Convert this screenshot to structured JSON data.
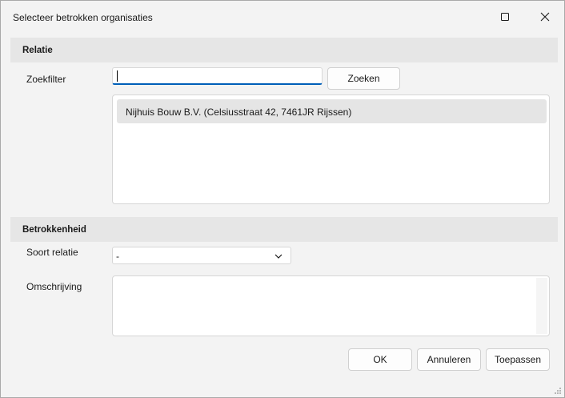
{
  "window": {
    "title": "Selecteer betrokken organisaties"
  },
  "relatie": {
    "header": "Relatie",
    "zoekfilter_label": "Zoekfilter",
    "search_value": "",
    "search_button": "Zoeken",
    "results": [
      "Nijhuis Bouw B.V.  (Celsiusstraat 42, 7461JR Rijssen)"
    ]
  },
  "betrokkenheid": {
    "header": "Betrokkenheid",
    "soort_relatie_label": "Soort relatie",
    "soort_relatie_value": "-",
    "omschrijving_label": "Omschrijving",
    "omschrijving_value": ""
  },
  "footer": {
    "ok": "OK",
    "cancel": "Annuleren",
    "apply": "Toepassen"
  },
  "colors": {
    "accent": "#005fb8",
    "background": "#f3f3f3",
    "section_header": "#e6e6e6",
    "selected_row": "#e5e5e5"
  },
  "icons": {
    "maximize": "maximize-icon",
    "close": "close-icon",
    "dropdown": "chevron-down-icon",
    "resize": "resize-grip-icon"
  }
}
